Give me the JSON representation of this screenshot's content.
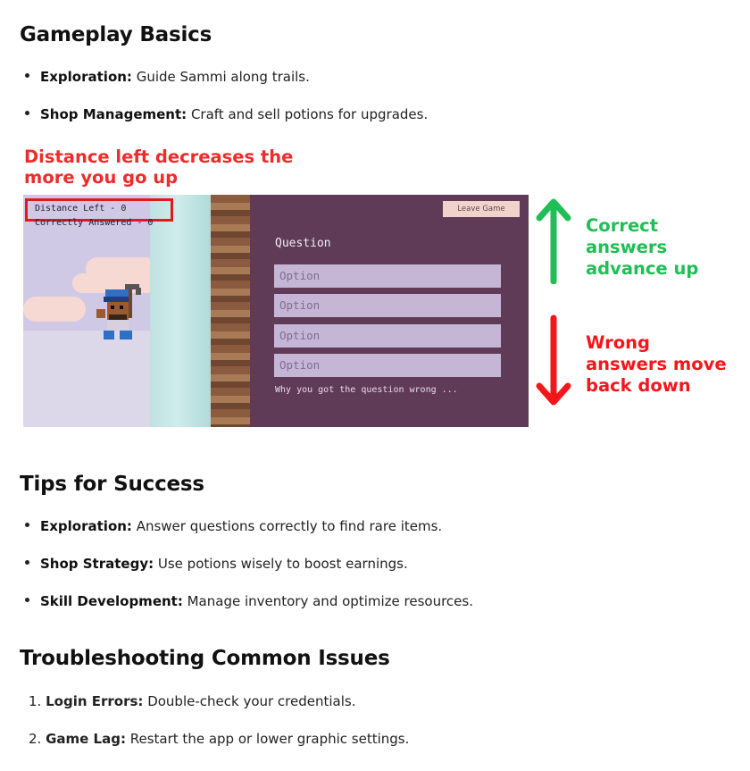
{
  "gameplay": {
    "title": "Gameplay Basics",
    "items": [
      {
        "label": "Exploration:",
        "text": " Guide Sammi along trails."
      },
      {
        "label": "Shop Management:",
        "text": " Craft and sell potions for upgrades."
      }
    ]
  },
  "annotations": {
    "distance_line1": "Distance left decreases the",
    "distance_line2": "more you go up",
    "correct_lines": [
      "Correct",
      "answers",
      "advance up"
    ],
    "wrong_lines": [
      "Wrong",
      "answers move",
      "back down"
    ],
    "colors": {
      "red": "#f02b2b",
      "green": "#1fbf55"
    }
  },
  "game": {
    "distance_left": "Distance Left - 0",
    "correctly_answered": "Correctly Answered - 0",
    "leave_button": "Leave Game",
    "question": "Question",
    "options": [
      "Option",
      "Option",
      "Option",
      "Option"
    ],
    "why_text": "Why you got the question wrong ..."
  },
  "tips": {
    "title": "Tips for Success",
    "items": [
      {
        "label": "Exploration:",
        "text": " Answer questions correctly to find rare items."
      },
      {
        "label": "Shop Strategy:",
        "text": " Use potions wisely to boost earnings."
      },
      {
        "label": "Skill Development:",
        "text": " Manage inventory and optimize resources."
      }
    ]
  },
  "troubleshooting": {
    "title": "Troubleshooting Common Issues",
    "items": [
      {
        "num": "1.",
        "label": "Login Errors:",
        "text": " Double-check your credentials."
      },
      {
        "num": "2.",
        "label": "Game Lag:",
        "text": " Restart the app or lower graphic settings."
      }
    ]
  }
}
